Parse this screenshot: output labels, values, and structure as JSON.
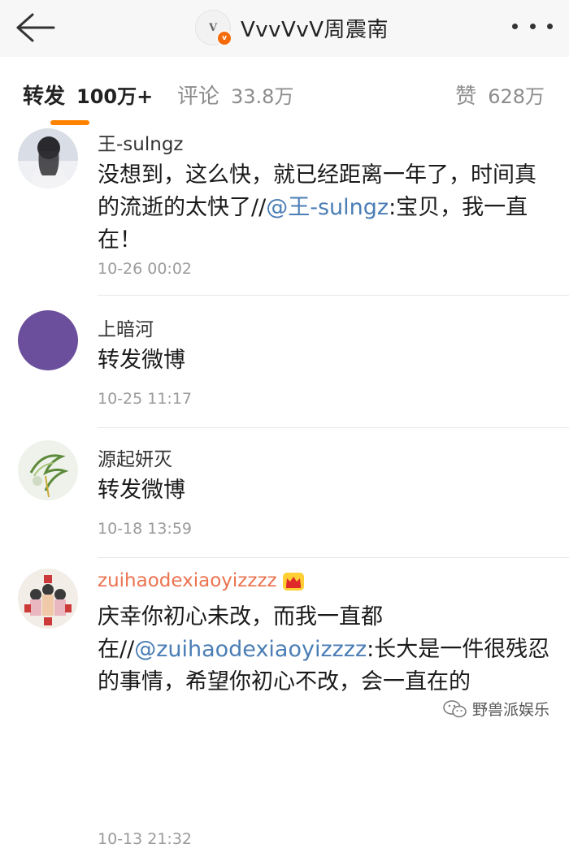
{
  "header": {
    "title": "VvvVvV周震南",
    "logo_mark": "V",
    "badge_mark": "v",
    "back_icon": "arrow-left-icon",
    "more_icon": "more-dots-icon"
  },
  "tabs": [
    {
      "label": "转发",
      "count": "100万+",
      "active": true
    },
    {
      "label": "评论",
      "count": "33.8万",
      "active": false
    },
    {
      "label": "赞",
      "count": "628万",
      "active": false
    }
  ],
  "colors": {
    "accent": "#ff8200",
    "mention": "#4b7eb5",
    "vip_name": "#eb7350"
  },
  "posts": [
    {
      "user": "王-sulngz",
      "text_before": "没想到，这么快，就已经距离一年了，时间真的流逝的太快了//",
      "mention": "@王-sulngz",
      "text_after": ":宝贝，我一直在！",
      "time": "10-26  00:02"
    },
    {
      "user": "上暗河",
      "text": "转发微博",
      "time": "10-25  11:17"
    },
    {
      "user": "源起妍灭",
      "text": "转发微博",
      "time": "10-18  13:59"
    },
    {
      "user": "zuihaodexiaoyizzzz",
      "user_badge": "crown-icon",
      "text_before": "庆幸你初心未改，而我一直都在//",
      "mention": "@zuihaodexiaoyizzzz",
      "text_after": ":长大是一件很残忍的事情，希望你初心不改，会一直在的",
      "time": "10-13  21:32"
    }
  ],
  "watermark": {
    "text": "野兽派娱乐",
    "icon": "wechat-icon"
  }
}
